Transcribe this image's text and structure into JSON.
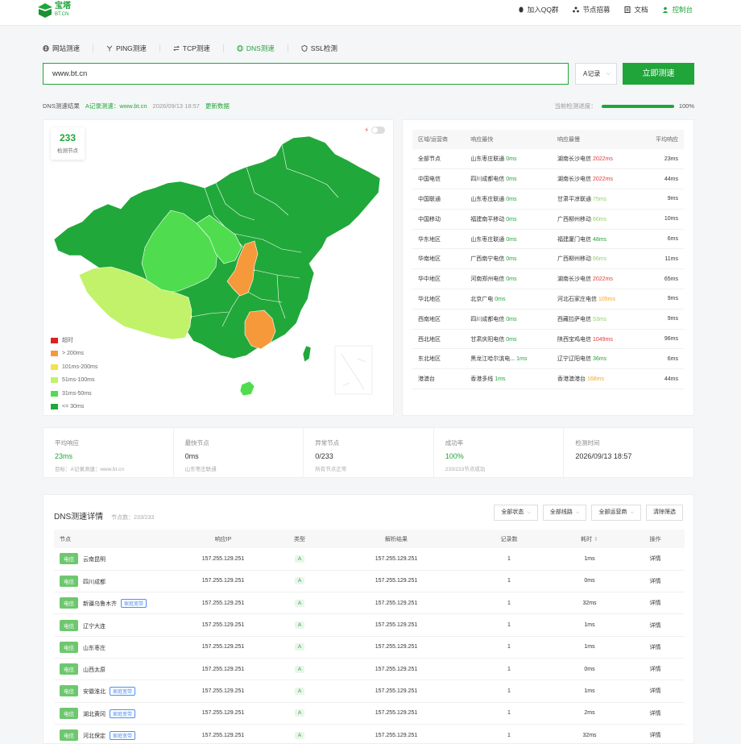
{
  "brand": {
    "name": "宝塔",
    "sub": "BT.CN",
    "color": "#20a53a"
  },
  "topnav": [
    {
      "icon": "qq-icon",
      "label": "加入QQ群"
    },
    {
      "icon": "network-icon",
      "label": "节点招募"
    },
    {
      "icon": "doc-icon",
      "label": "文档"
    },
    {
      "icon": "user-icon",
      "label": "控制台"
    }
  ],
  "tabs": [
    {
      "icon": "globe-icon",
      "label": "网站测速"
    },
    {
      "icon": "ping-icon",
      "label": "PING测速"
    },
    {
      "icon": "tcp-icon",
      "label": "TCP测速"
    },
    {
      "icon": "dns-icon",
      "label": "DNS测速",
      "active": true
    },
    {
      "icon": "shield-icon",
      "label": "SSL检测"
    }
  ],
  "search": {
    "value": "www.bt.cn",
    "record_type": "A记录",
    "button": "立即测速"
  },
  "result": {
    "label": "DNS测速结果",
    "target": "A记录测速：www.bt.cn",
    "time": "2026/09/13 18:57",
    "refresh": "更新数据",
    "progress_label": "当前检测进度：",
    "progress": 100,
    "progress_text": "100%"
  },
  "map": {
    "node_count": "233",
    "node_label": "检测节点",
    "legend": [
      {
        "label": "超时",
        "color": "#e02020"
      },
      {
        "label": "> 200ms",
        "color": "#f6993b"
      },
      {
        "label": "101ms-200ms",
        "color": "#f5e243"
      },
      {
        "label": "51ms-100ms",
        "color": "#c1f26a"
      },
      {
        "label": "31ms-50ms",
        "color": "#4fdd4f"
      },
      {
        "label": "<= 30ms",
        "color": "#21a83a"
      }
    ]
  },
  "region_table": {
    "headers": [
      "区域/运营商",
      "响应最快",
      "响应最慢",
      "平均响应"
    ],
    "rows": [
      {
        "region": "全部节点",
        "fast": "山东枣庄联通",
        "fast_ms": "0ms",
        "slow": "湖南长沙电信",
        "slow_ms": "2022ms",
        "slow_color": "red",
        "avg": "23ms",
        "avg_color": "green"
      },
      {
        "region": "中国电信",
        "fast": "四川成都电信",
        "fast_ms": "0ms",
        "slow": "湖南长沙电信",
        "slow_ms": "2022ms",
        "slow_color": "red",
        "avg": "44ms",
        "avg_color": "green"
      },
      {
        "region": "中国联通",
        "fast": "山东枣庄联通",
        "fast_ms": "0ms",
        "slow": "甘肃平凉联通",
        "slow_ms": "75ms",
        "slow_color": "lgreen",
        "avg": "9ms",
        "avg_color": "green"
      },
      {
        "region": "中国移动",
        "fast": "福建南平移动",
        "fast_ms": "0ms",
        "slow": "广西柳州移动",
        "slow_ms": "66ms",
        "slow_color": "lgreen",
        "avg": "10ms",
        "avg_color": "green"
      },
      {
        "region": "华东地区",
        "fast": "山东枣庄联通",
        "fast_ms": "0ms",
        "slow": "福建厦门电信",
        "slow_ms": "48ms",
        "slow_color": "green",
        "avg": "6ms",
        "avg_color": "green"
      },
      {
        "region": "华南地区",
        "fast": "广西南宁电信",
        "fast_ms": "0ms",
        "slow": "广西柳州移动",
        "slow_ms": "66ms",
        "slow_color": "lgreen",
        "avg": "11ms",
        "avg_color": "green"
      },
      {
        "region": "华中地区",
        "fast": "河南郑州电信",
        "fast_ms": "0ms",
        "slow": "湖南长沙电信",
        "slow_ms": "2022ms",
        "slow_color": "red",
        "avg": "65ms",
        "avg_color": "lgreen"
      },
      {
        "region": "华北地区",
        "fast": "北京广电",
        "fast_ms": "0ms",
        "slow": "河北石家庄电信",
        "slow_ms": "105ms",
        "slow_color": "orange",
        "avg": "9ms",
        "avg_color": "green"
      },
      {
        "region": "西南地区",
        "fast": "四川成都电信",
        "fast_ms": "0ms",
        "slow": "西藏拉萨电信",
        "slow_ms": "53ms",
        "slow_color": "lgreen",
        "avg": "9ms",
        "avg_color": "green"
      },
      {
        "region": "西北地区",
        "fast": "甘肃庆阳电信",
        "fast_ms": "0ms",
        "slow": "陕西宝鸡电信",
        "slow_ms": "1049ms",
        "slow_color": "red",
        "avg": "96ms",
        "avg_color": "lgreen"
      },
      {
        "region": "东北地区",
        "fast": "黑龙江哈尔滨电...",
        "fast_ms": "1ms",
        "slow": "辽宁辽阳电信",
        "slow_ms": "36ms",
        "slow_color": "green",
        "avg": "6ms",
        "avg_color": "green"
      },
      {
        "region": "港澳台",
        "fast": "香港多线",
        "fast_ms": "1ms",
        "slow": "香港澳港台",
        "slow_ms": "168ms",
        "slow_color": "orange",
        "avg": "44ms",
        "avg_color": "green"
      }
    ]
  },
  "stats": [
    {
      "label": "平均响应",
      "value": "23ms",
      "green": true,
      "sub": "目标：A记录测速：www.bt.cn"
    },
    {
      "label": "最快节点",
      "value": "0ms",
      "green": false,
      "sub": "山东枣庄联通"
    },
    {
      "label": "异常节点",
      "value": "0/233",
      "green": false,
      "sub": "所有节点正常"
    },
    {
      "label": "成功率",
      "value": "100%",
      "green": true,
      "sub": "233/233节点成功"
    },
    {
      "label": "检测时间",
      "value": "2026/09/13 18:57",
      "green": false,
      "sub": ""
    }
  ],
  "details": {
    "title": "DNS测速详情",
    "count": "节点数：233/233",
    "filters": [
      "全部状态",
      "全部线路",
      "全部运营商"
    ],
    "clear": "清除筛选",
    "headers": [
      "节点",
      "响应IP",
      "类型",
      "解析结果",
      "记录数",
      "耗时",
      "操作"
    ],
    "rows": [
      {
        "isp": "电信",
        "node": "云南昆明",
        "tag": "",
        "ip": "157.255.129.251",
        "type": "A",
        "result": "157.255.129.251",
        "records": "1",
        "time": "1ms",
        "time_color": "green",
        "action": "详情"
      },
      {
        "isp": "电信",
        "node": "四川成都",
        "tag": "",
        "ip": "157.255.129.251",
        "type": "A",
        "result": "157.255.129.251",
        "records": "1",
        "time": "0ms",
        "time_color": "green",
        "action": "详情"
      },
      {
        "isp": "电信",
        "node": "新疆乌鲁木齐",
        "tag": "家庭宽带",
        "ip": "157.255.129.251",
        "type": "A",
        "result": "157.255.129.251",
        "records": "1",
        "time": "32ms",
        "time_color": "lgreen",
        "action": "详情"
      },
      {
        "isp": "电信",
        "node": "辽宁大连",
        "tag": "",
        "ip": "157.255.129.251",
        "type": "A",
        "result": "157.255.129.251",
        "records": "1",
        "time": "1ms",
        "time_color": "green",
        "action": "详情"
      },
      {
        "isp": "电信",
        "node": "山东枣庄",
        "tag": "",
        "ip": "157.255.129.251",
        "type": "A",
        "result": "157.255.129.251",
        "records": "1",
        "time": "1ms",
        "time_color": "green",
        "action": "详情"
      },
      {
        "isp": "电信",
        "node": "山西太原",
        "tag": "",
        "ip": "157.255.129.251",
        "type": "A",
        "result": "157.255.129.251",
        "records": "1",
        "time": "0ms",
        "time_color": "green",
        "action": "详情"
      },
      {
        "isp": "电信",
        "node": "安徽淮北",
        "tag": "家庭宽带",
        "ip": "157.255.129.251",
        "type": "A",
        "result": "157.255.129.251",
        "records": "1",
        "time": "1ms",
        "time_color": "green",
        "action": "详情"
      },
      {
        "isp": "电信",
        "node": "湖北黄冈",
        "tag": "家庭宽带",
        "ip": "157.255.129.251",
        "type": "A",
        "result": "157.255.129.251",
        "records": "1",
        "time": "2ms",
        "time_color": "green",
        "action": "详情"
      },
      {
        "isp": "电信",
        "node": "河北保定",
        "tag": "家庭宽带",
        "ip": "157.255.129.251",
        "type": "A",
        "result": "157.255.129.251",
        "records": "1",
        "time": "32ms",
        "time_color": "lgreen",
        "action": "详情"
      }
    ]
  }
}
